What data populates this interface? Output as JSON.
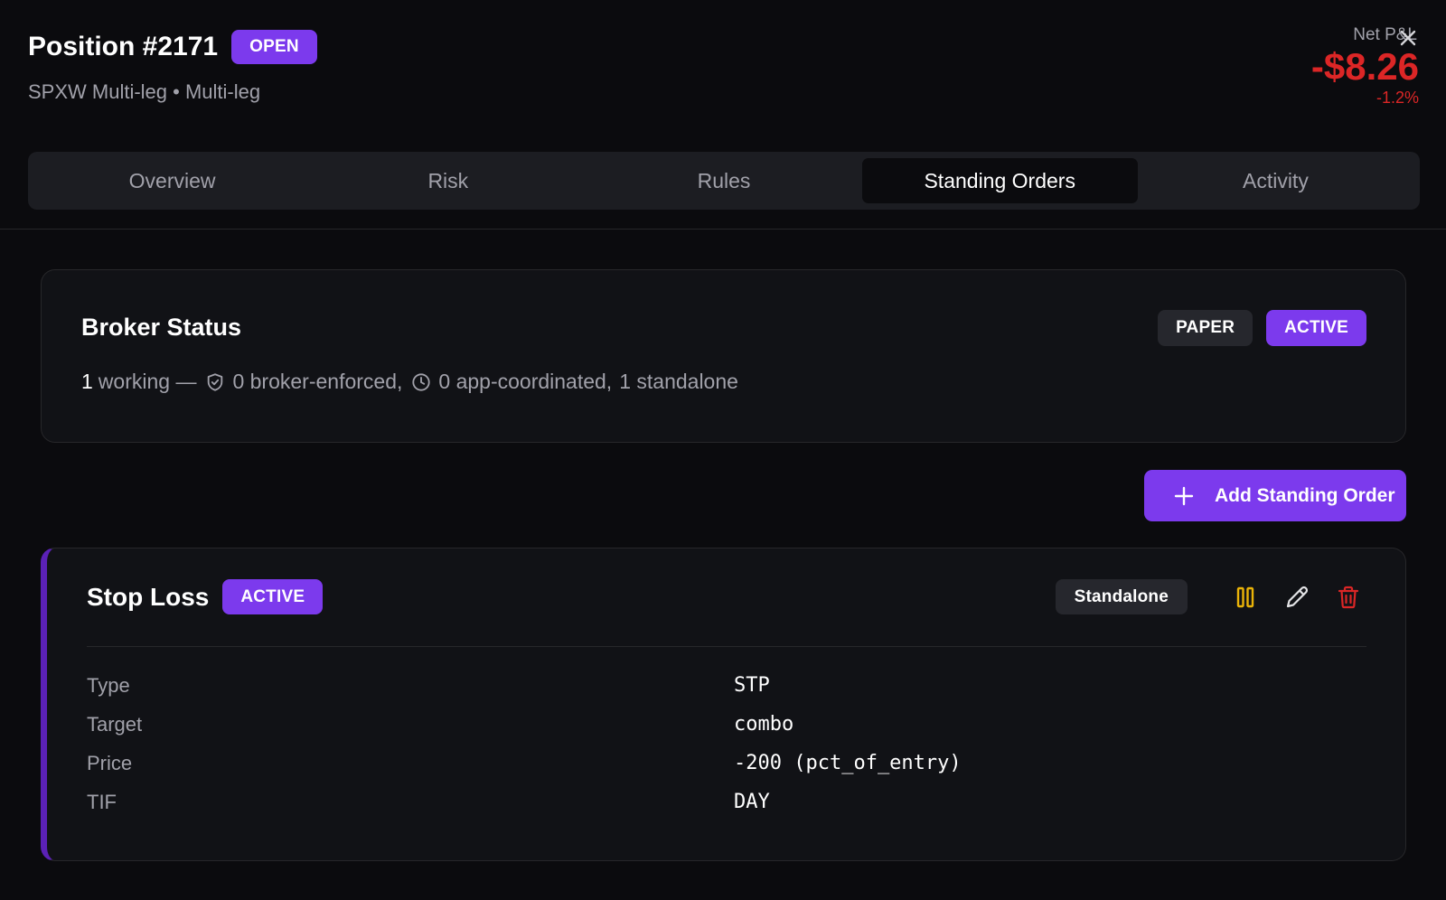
{
  "header": {
    "title": "Position #2171",
    "status_badge": "OPEN",
    "subtitle": "SPXW Multi-leg • Multi-leg",
    "pnl_label": "Net P&L",
    "pnl_value": "-$8.26",
    "pnl_pct": "-1.2%"
  },
  "tabs": [
    {
      "label": "Overview"
    },
    {
      "label": "Risk"
    },
    {
      "label": "Rules"
    },
    {
      "label": "Standing Orders",
      "active": true
    },
    {
      "label": "Activity"
    }
  ],
  "broker_status": {
    "title": "Broker Status",
    "badges": [
      "PAPER",
      "ACTIVE"
    ],
    "working_count": "1",
    "working_label": "working —",
    "broker_enforced": "0 broker-enforced,",
    "app_coordinated": "0 app-coordinated,",
    "standalone": "1 standalone"
  },
  "add_button_label": "Add Standing Order",
  "order": {
    "title": "Stop Loss",
    "status": "ACTIVE",
    "mode": "Standalone",
    "details": [
      {
        "label": "Type",
        "value": "STP"
      },
      {
        "label": "Target",
        "value": "combo"
      },
      {
        "label": "Price",
        "value": "-200 (pct_of_entry)"
      },
      {
        "label": "TIF",
        "value": "DAY"
      }
    ]
  },
  "colors": {
    "accent": "#7c3aed",
    "negative": "#dc2626",
    "pause": "#eab308",
    "delete": "#dc2626"
  },
  "icons": [
    "close-icon",
    "shield-icon",
    "clock-icon",
    "plus-icon",
    "pause-icon",
    "pencil-icon",
    "trash-icon"
  ]
}
